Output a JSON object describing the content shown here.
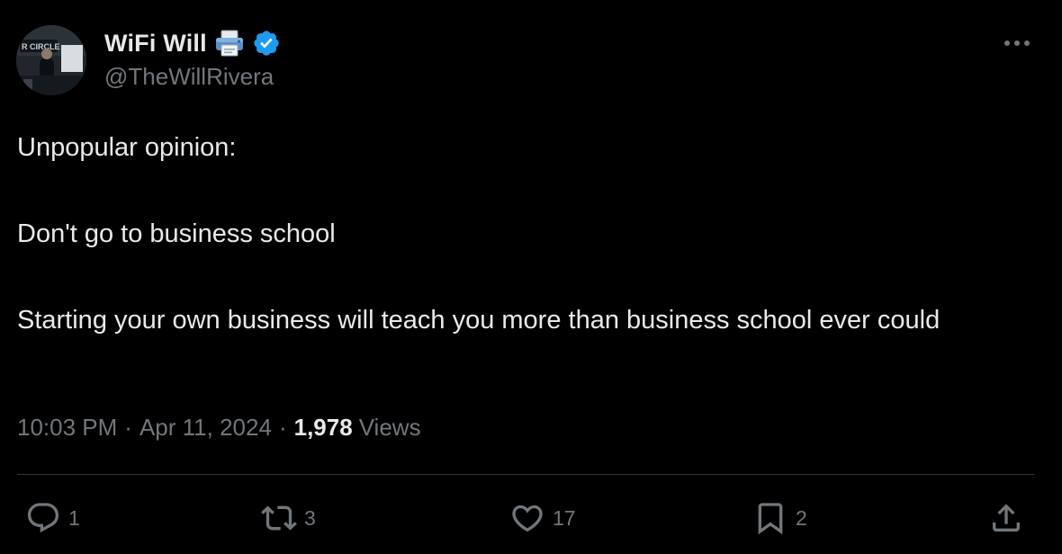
{
  "user": {
    "display_name": "WiFi Will",
    "handle": "@TheWillRivera",
    "name_emoji": "printer-icon",
    "verified": "verified-badge-icon",
    "avatar_sign_text": "R CIRCLE"
  },
  "tweet": {
    "lines": [
      "Unpopular opinion:",
      "Don't go to business school",
      "Starting your own business will teach you more than business school ever could"
    ],
    "time": "10:03 PM",
    "separator": "·",
    "date": "Apr 11, 2024",
    "views_count": "1,978",
    "views_label": "Views"
  },
  "actions": {
    "reply_count": "1",
    "repost_count": "3",
    "like_count": "17",
    "bookmark_count": "2"
  },
  "colors": {
    "background": "#000000",
    "text_primary": "#e7e9ea",
    "text_secondary": "#71767b",
    "verified_blue": "#1d9bf0",
    "divider": "#2f3336"
  }
}
